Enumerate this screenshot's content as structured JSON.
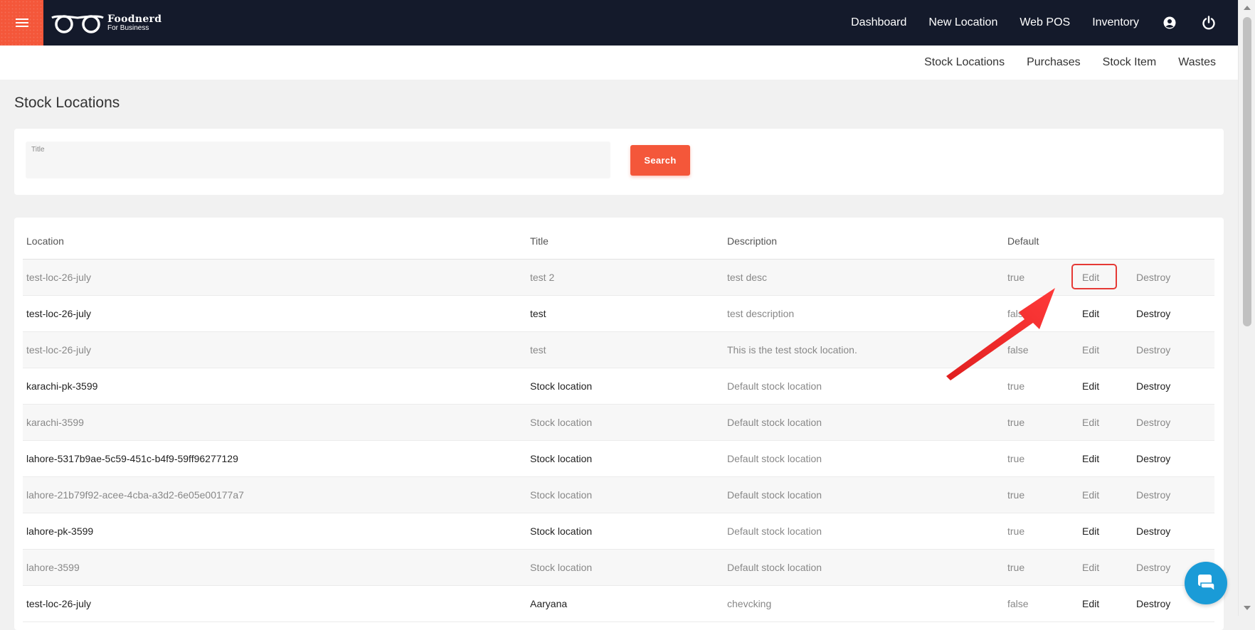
{
  "brand": {
    "name": "Foodnerd",
    "tagline": "For Business"
  },
  "top_nav": [
    "Dashboard",
    "New Location",
    "Web POS",
    "Inventory"
  ],
  "sub_nav": [
    "Stock Locations",
    "Purchases",
    "Stock Item",
    "Wastes"
  ],
  "page_title": "Stock Locations",
  "filter": {
    "title_label": "Title",
    "title_value": "",
    "search_label": "Search"
  },
  "table": {
    "headers": {
      "location": "Location",
      "title": "Title",
      "description": "Description",
      "default": "Default"
    },
    "actions": {
      "edit": "Edit",
      "destroy": "Destroy"
    },
    "rows": [
      {
        "location": "test-loc-26-july",
        "title": "test 2",
        "description": "test desc",
        "default": "true"
      },
      {
        "location": "test-loc-26-july",
        "title": "test",
        "description": "test description",
        "default": "false"
      },
      {
        "location": "test-loc-26-july",
        "title": "test",
        "description": "This is the test stock location.",
        "default": "false"
      },
      {
        "location": "karachi-pk-3599",
        "title": "Stock location",
        "description": "Default stock location",
        "default": "true"
      },
      {
        "location": "karachi-3599",
        "title": "Stock location",
        "description": "Default stock location",
        "default": "true"
      },
      {
        "location": "lahore-5317b9ae-5c59-451c-b4f9-59ff96277129",
        "title": "Stock location",
        "description": "Default stock location",
        "default": "true"
      },
      {
        "location": "lahore-21b79f92-acee-4cba-a3d2-6e05e00177a7",
        "title": "Stock location",
        "description": "Default stock location",
        "default": "true"
      },
      {
        "location": "lahore-pk-3599",
        "title": "Stock location",
        "description": "Default stock location",
        "default": "true"
      },
      {
        "location": "lahore-3599",
        "title": "Stock location",
        "description": "Default stock location",
        "default": "true"
      },
      {
        "location": "test-loc-26-july",
        "title": "Aaryana",
        "description": "chevcking",
        "default": "false"
      }
    ]
  },
  "colors": {
    "topbar": "#141a2b",
    "accent": "#f4573a",
    "highlight": "#e53935",
    "chat": "#1a9bd7"
  },
  "icons": [
    "menu-icon",
    "glasses-logo-icon",
    "account-icon",
    "power-icon",
    "chat-icon",
    "annotation-arrow"
  ]
}
